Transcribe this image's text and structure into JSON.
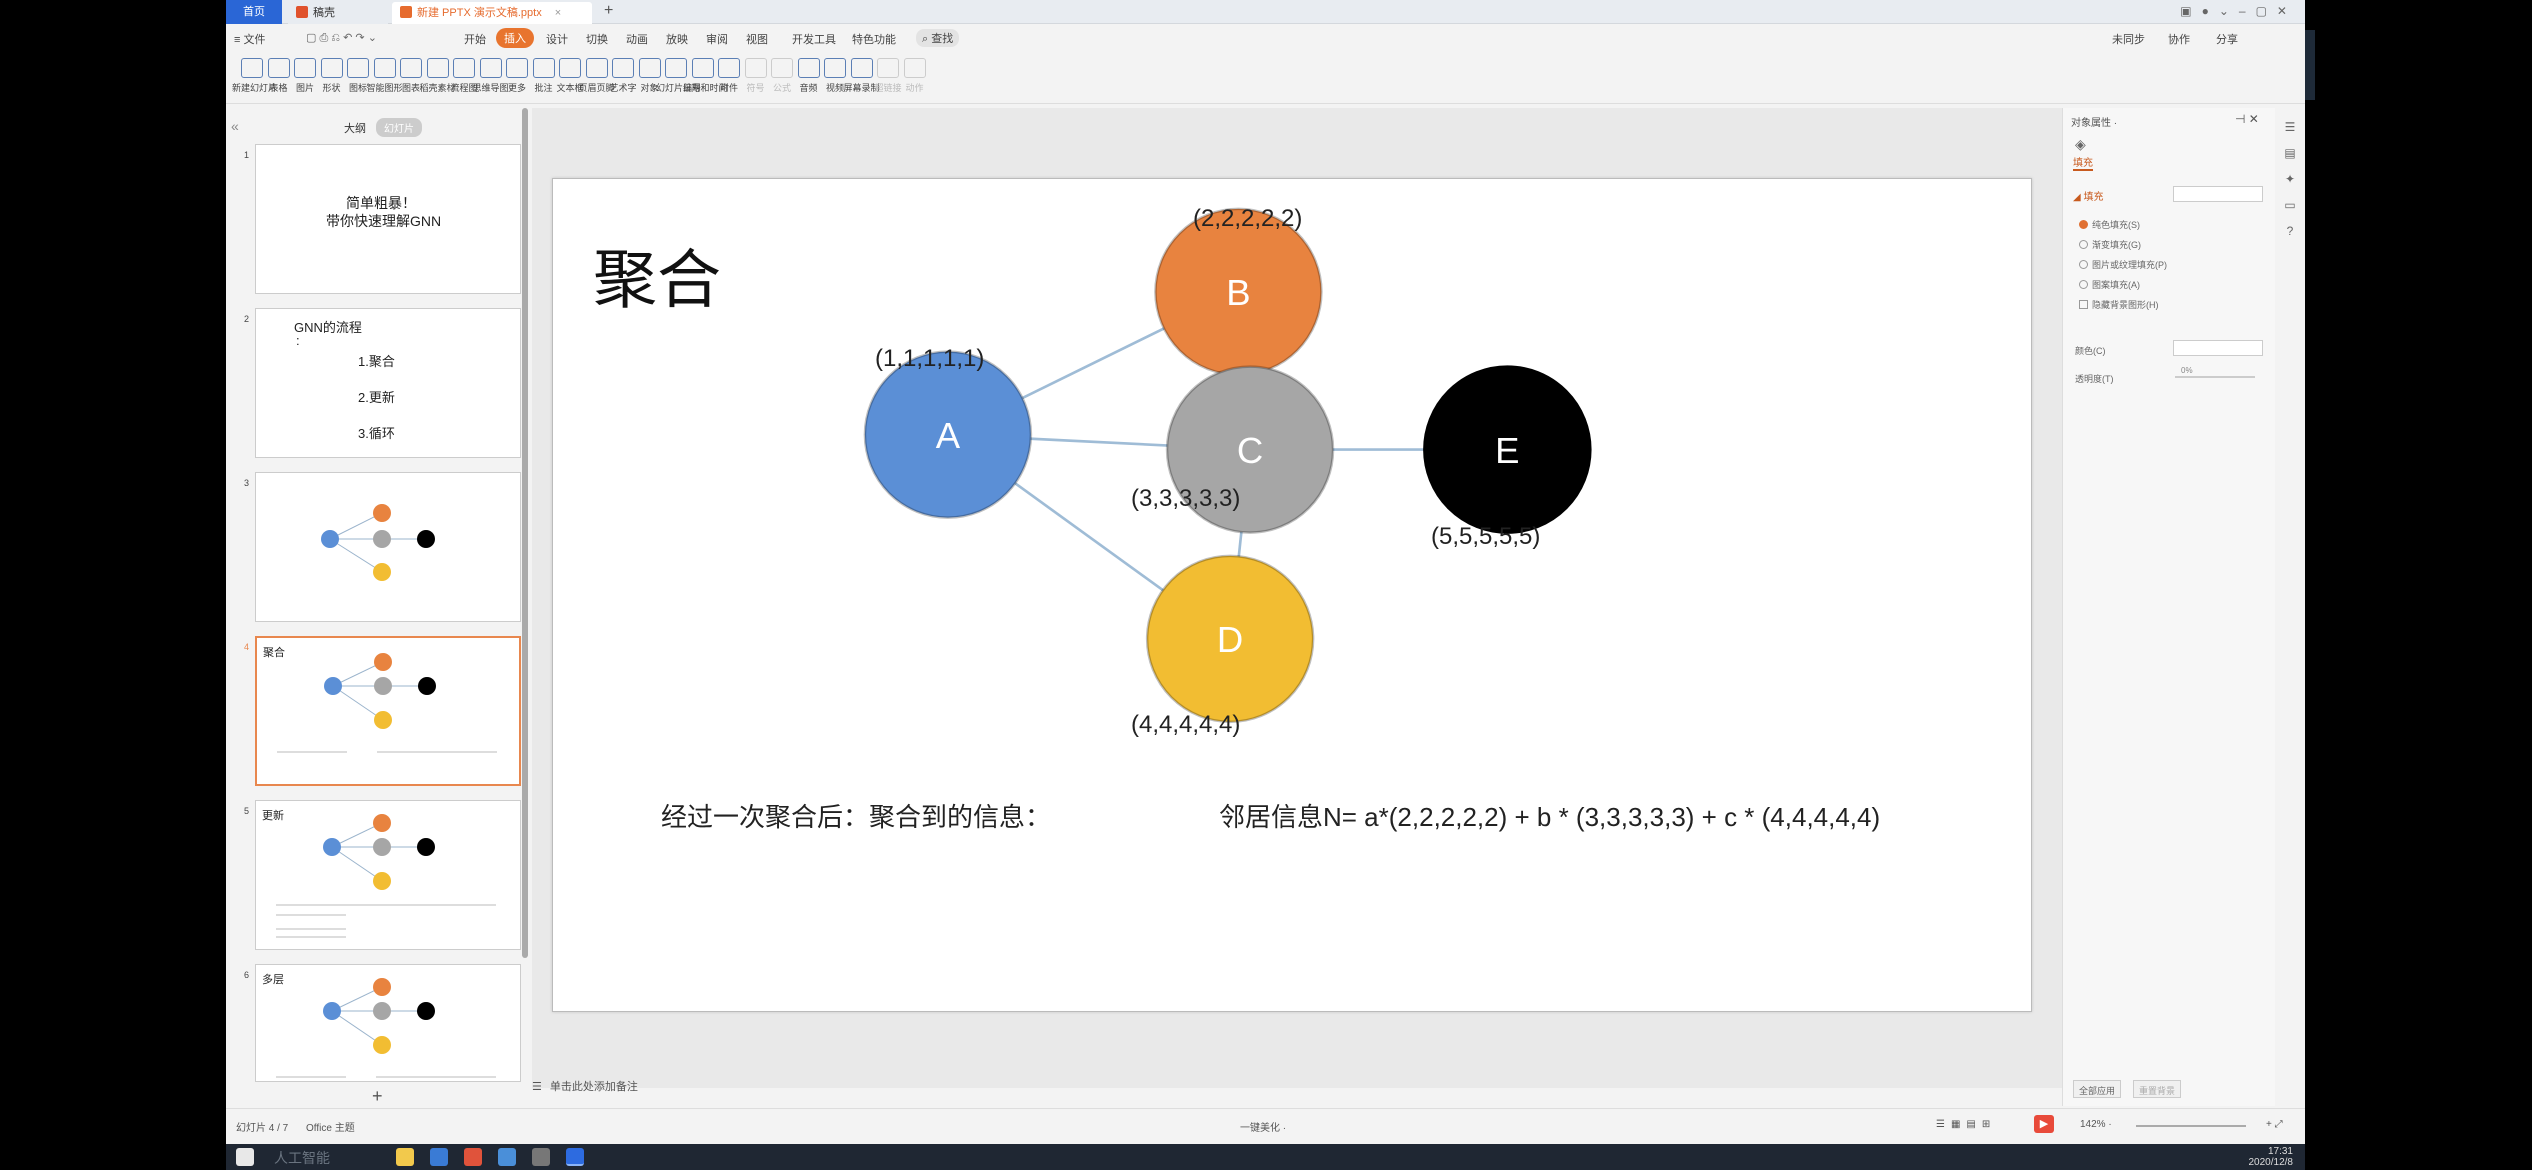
{
  "titlebar": {
    "tabs": [
      {
        "label": "首页"
      },
      {
        "label": "稿壳"
      },
      {
        "label": "新建 PPTX 演示文稿.pptx"
      }
    ],
    "new_tab": "+"
  },
  "menubar": {
    "file": "≡ 文件",
    "items": [
      "开始",
      "插入",
      "设计",
      "切换",
      "动画",
      "放映",
      "审阅",
      "视图",
      "开发工具",
      "特色功能"
    ],
    "active": "插入",
    "search": "查找",
    "right": [
      "未同步",
      "协作",
      "分享"
    ]
  },
  "ribbon": {
    "buttons": [
      "新建幻灯片",
      "表格",
      "图片",
      "形状",
      "图标",
      "智能图形",
      "图表",
      "稻壳素材",
      "流程图",
      "思维导图",
      "更多",
      "批注",
      "文本框",
      "页眉页脚",
      "艺术字",
      "对象",
      "幻灯片编号",
      "日期和时间",
      "附件",
      "符号",
      "公式",
      "音频",
      "视频",
      "屏幕录制",
      "超链接",
      "动作"
    ],
    "disabled": [
      "符号",
      "公式",
      "超链接",
      "动作"
    ]
  },
  "thumbpane": {
    "tabs": [
      "大纲",
      "幻灯片"
    ],
    "slides": [
      {
        "num": "1",
        "title_lines": [
          "简单粗暴！",
          "带你快速理解GNN"
        ]
      },
      {
        "num": "2",
        "title_lines": [
          "GNN的流程",
          ":",
          "1.聚合",
          "2.更新",
          "3.循环"
        ]
      },
      {
        "num": "3",
        "title_lines": []
      },
      {
        "num": "4",
        "title_lines": [
          "聚合"
        ]
      },
      {
        "num": "5",
        "title_lines": [
          "更新"
        ]
      },
      {
        "num": "6",
        "title_lines": [
          "多层"
        ]
      }
    ],
    "add": "+"
  },
  "slide": {
    "title": "聚合",
    "nodes": [
      {
        "id": "A",
        "label": "A",
        "vector": "(1,1,1,1,1)",
        "color": "#5b8fd6"
      },
      {
        "id": "B",
        "label": "B",
        "vector": "(2,2,2,2,2)",
        "color": "#e8833f"
      },
      {
        "id": "C",
        "label": "C",
        "vector": "(3,3,3,3,3)",
        "color": "#a6a6a6"
      },
      {
        "id": "D",
        "label": "D",
        "vector": "(4,4,4,4,4)",
        "color": "#f2bd32"
      },
      {
        "id": "E",
        "label": "E",
        "vector": "(5,5,5,5,5)",
        "color": "#000000"
      }
    ],
    "edges": [
      [
        "A",
        "B"
      ],
      [
        "A",
        "C"
      ],
      [
        "A",
        "D"
      ],
      [
        "B",
        "C"
      ],
      [
        "C",
        "D"
      ],
      [
        "C",
        "E"
      ]
    ],
    "caption_left": "经过一次聚合后：聚合到的信息：",
    "caption_right": "邻居信息N=  a*(2,2,2,2,2)    + b * (3,3,3,3,3)   +   c * (4,4,4,4,4)"
  },
  "notes": "单击此处添加备注",
  "props": {
    "title": "对象属性 ·",
    "tab": "填充",
    "section": "◢ 填充",
    "options": [
      {
        "label": "纯色填充(S)",
        "type": "radio",
        "on": true
      },
      {
        "label": "渐变填充(G)",
        "type": "radio",
        "on": false
      },
      {
        "label": "图片或纹理填充(P)",
        "type": "radio",
        "on": false
      },
      {
        "label": "图案填充(A)",
        "type": "radio",
        "on": false
      },
      {
        "label": "隐藏背景图形(H)",
        "type": "check",
        "on": false
      }
    ],
    "color_label": "颜色(C)",
    "transparency_label": "透明度(T)",
    "transparency_value": "0%",
    "apply_all": "全部应用",
    "reset_bg": "重置背景"
  },
  "status": {
    "slide_pos": "幻灯片 4 / 7",
    "theme": "Office 主题",
    "beautify": "一键美化 ·",
    "zoom": "142% ·"
  },
  "taskbar": {
    "time": "17:31",
    "date": "2020/12/8",
    "watermark": "人工智能"
  }
}
